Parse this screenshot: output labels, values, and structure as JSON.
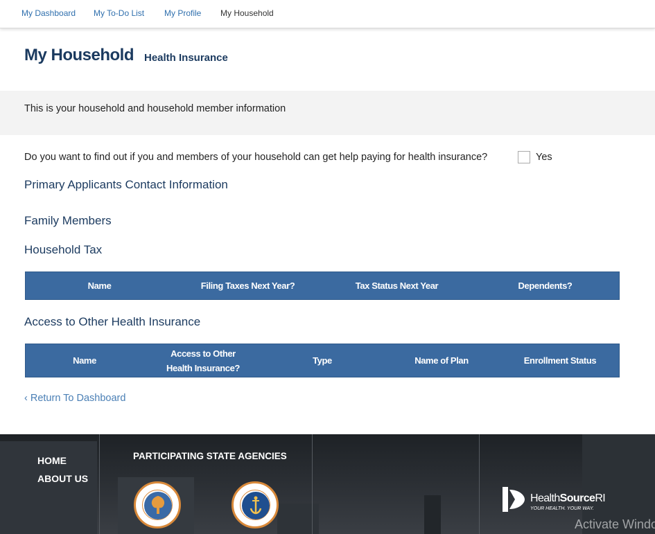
{
  "nav": {
    "items": [
      {
        "label": "My Dashboard"
      },
      {
        "label": "My To-Do List"
      },
      {
        "label": "My Profile"
      },
      {
        "label": "My Household"
      }
    ]
  },
  "header": {
    "title": "My Household",
    "subtitle": "Health Insurance"
  },
  "info": {
    "text": "This is your household and household member information"
  },
  "question": {
    "text": "Do you want to find out if you and members of your household can get help paying for health insurance?",
    "checkbox_label": "Yes",
    "checked": false
  },
  "sections": {
    "primary_contact": "Primary Applicants Contact Information",
    "family_members": "Family Members",
    "household_tax": "Household Tax",
    "other_insurance": "Access to Other Health Insurance"
  },
  "tax_table": {
    "columns": [
      "Name",
      "Filing Taxes Next Year?",
      "Tax Status Next Year",
      "Dependents?"
    ]
  },
  "insurance_table": {
    "columns": [
      "Name",
      "Access to Other Health Insurance?",
      "Type",
      "Name of Plan",
      "Enrollment Status"
    ]
  },
  "return_link": "‹ Return To Dashboard",
  "footer": {
    "links": [
      "HOME",
      "ABOUT US"
    ],
    "agencies_title": "PARTICIPATING STATE AGENCIES",
    "agencies": [
      {
        "icon": "ri-department-human-services-seal-icon"
      },
      {
        "icon": "ri-executive-office-health-human-services-seal-icon"
      }
    ],
    "brand": {
      "name_regular": "Health",
      "name_bold": "Source",
      "name_suffix": "RI",
      "tagline": "YOUR HEALTH. YOUR WAY."
    }
  },
  "watermark": "Activate Windows",
  "colors": {
    "primary_navy": "#1b3a5f",
    "table_header_blue": "#3b6aa0",
    "link_blue": "#2f6fad",
    "seal_orange": "#d8893a"
  }
}
